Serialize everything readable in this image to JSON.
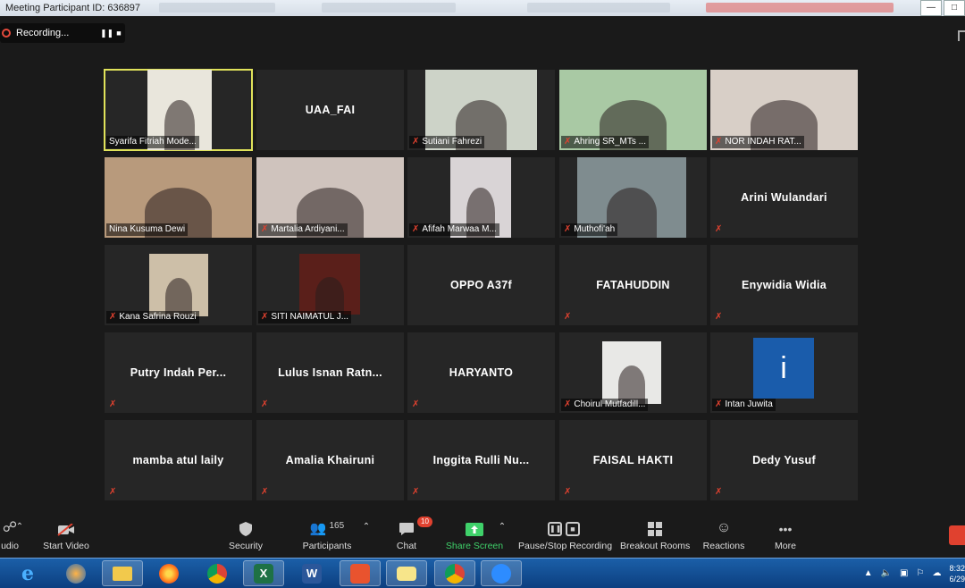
{
  "window": {
    "title": "Meeting Participant ID: 636897",
    "min_icon": "minimize-icon",
    "max_icon": "maximize-icon"
  },
  "recording": {
    "label": "Recording...",
    "pause_icon": "pause-icon",
    "stop_icon": "stop-icon"
  },
  "tiles": [
    {
      "name": "Syarifa Fitriah Mode...",
      "kind": "video",
      "muted": false,
      "active": true,
      "bg": "#e9e6dc"
    },
    {
      "name": "UAA_FAI",
      "kind": "name"
    },
    {
      "name": "Sutiani Fahrezi",
      "kind": "video",
      "muted": true,
      "bg": "#cdd3c8"
    },
    {
      "name": "Ahring SR_MTs ...",
      "kind": "video",
      "muted": true,
      "bg": "#a9c9a4"
    },
    {
      "name": "NOR INDAH RAT...",
      "kind": "video",
      "muted": true,
      "bg": "#d8cfc7"
    },
    {
      "name": "Nina Kusuma Dewi",
      "kind": "video",
      "muted": false,
      "bg": "#b89a7c"
    },
    {
      "name": "Martalia Ardiyani...",
      "kind": "video",
      "muted": true,
      "bg": "#cfc3bd"
    },
    {
      "name": "Afifah Marwaa M...",
      "kind": "video",
      "muted": true,
      "bg": "#d9d4d6"
    },
    {
      "name": "Muthofi'ah",
      "kind": "video",
      "muted": true,
      "bg": "#7f8c8f"
    },
    {
      "name": "Arini Wulandari",
      "kind": "name",
      "muted": true
    },
    {
      "name": "Kana Safrina Rouzi",
      "kind": "video",
      "muted": true,
      "bg": "#cdbfa8"
    },
    {
      "name": "SITI NAIMATUL J...",
      "kind": "video",
      "muted": true,
      "bg": "#5a1f1a"
    },
    {
      "name": "OPPO A37f",
      "kind": "name",
      "muted": false
    },
    {
      "name": "FATAHUDDIN",
      "kind": "name",
      "muted": true
    },
    {
      "name": "Enywidia Widia",
      "kind": "name",
      "muted": true
    },
    {
      "name": "Putry Indah Per...",
      "kind": "name",
      "muted": true
    },
    {
      "name": "Lulus Isnan Ratn...",
      "kind": "name",
      "muted": true
    },
    {
      "name": "HARYANTO",
      "kind": "name",
      "muted": true
    },
    {
      "name": "Choirul Mutfadill...",
      "kind": "video",
      "muted": true,
      "bg": "#e8e8e6"
    },
    {
      "name": "Intan Juwita",
      "kind": "avatar",
      "muted": true,
      "bg": "#1a5cab",
      "letter": "i"
    },
    {
      "name": "mamba atul laily",
      "kind": "name",
      "muted": true
    },
    {
      "name": "Amalia Khairuni",
      "kind": "name",
      "muted": true
    },
    {
      "name": "Inggita Rulli Nu...",
      "kind": "name",
      "muted": true
    },
    {
      "name": "FAISAL HAKTI",
      "kind": "name",
      "muted": true
    },
    {
      "name": "Dedy Yusuf",
      "kind": "name",
      "muted": true
    }
  ],
  "toolbar": {
    "audio": "udio",
    "start_video": "Start Video",
    "security": "Security",
    "participants": "Participants",
    "participants_count": "165",
    "chat": "Chat",
    "chat_badge": "10",
    "share_screen": "Share Screen",
    "recording": "Pause/Stop Recording",
    "breakout": "Breakout Rooms",
    "reactions": "Reactions",
    "more": "More"
  },
  "taskbar": {
    "apps": [
      "ie-icon",
      "media-player-icon",
      "file-explorer-icon",
      "firefox-icon",
      "chrome-icon",
      "excel-icon",
      "word-icon",
      "pdf-icon",
      "sticky-notes-icon",
      "chrome-profile-icon",
      "zoom-icon"
    ],
    "clock_time": "8:32",
    "clock_date": "6/29"
  },
  "colors": {
    "active_border": "#e0e25a",
    "mute_red": "#e0412f",
    "share_green": "#3fd16a"
  }
}
